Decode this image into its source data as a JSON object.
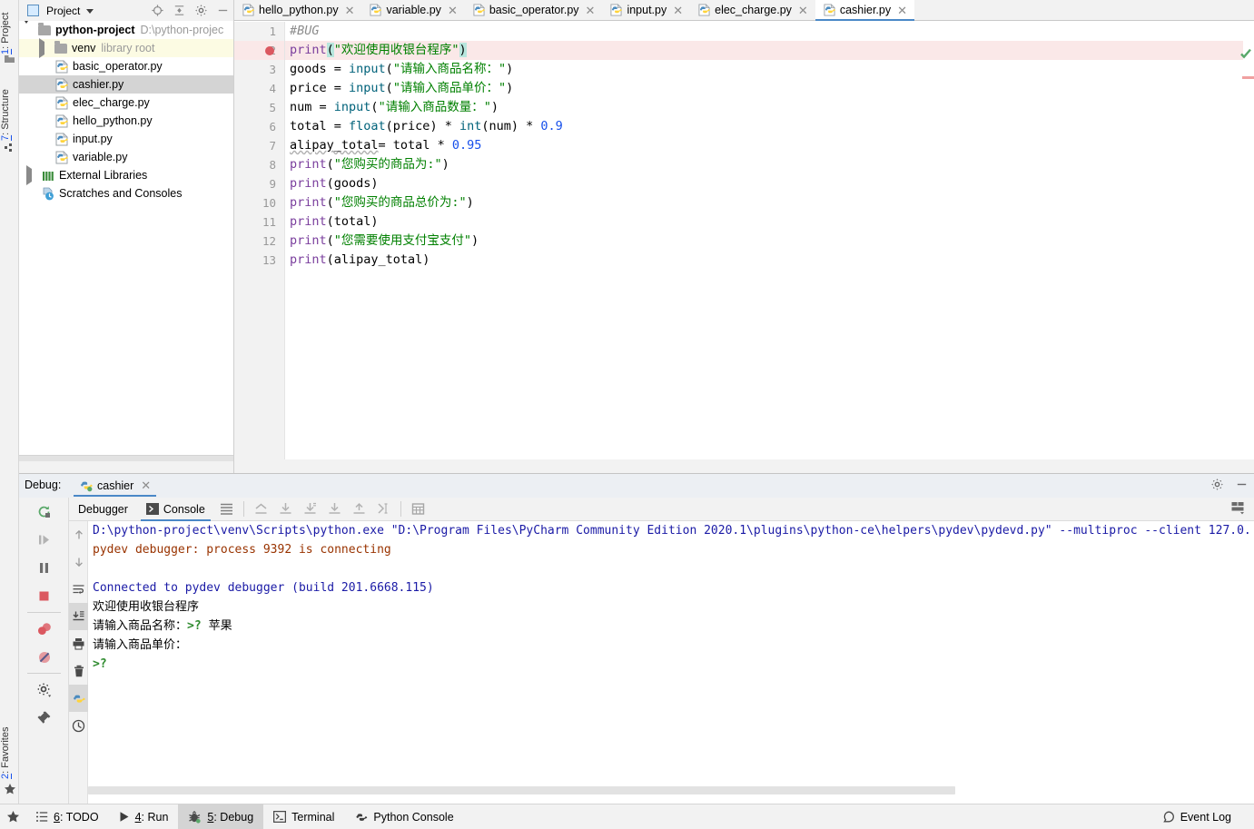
{
  "app": {
    "title": "PyCharm Community Edition 2020.1"
  },
  "left_strip": {
    "tabs": [
      {
        "num": "1",
        "label": ": Project",
        "icon": "project-icon"
      },
      {
        "num": "7",
        "label": ": Structure",
        "icon": "structure-icon"
      },
      {
        "num": "2",
        "label": ": Favorites",
        "icon": "star-icon"
      }
    ]
  },
  "project_panel": {
    "title": "Project",
    "icons": [
      "locate-icon",
      "collapse-all-icon",
      "gear-icon",
      "hide-icon"
    ],
    "tree": [
      {
        "label": "python-project",
        "suffix": "D:\\python-projec",
        "type": "folder",
        "expanded": true,
        "depth": 0,
        "bold": true
      },
      {
        "label": "venv",
        "suffix": "library root",
        "type": "folder",
        "expanded": false,
        "depth": 1,
        "highlight": "venv"
      },
      {
        "label": "basic_operator.py",
        "suffix": "",
        "type": "python",
        "depth": 2
      },
      {
        "label": "cashier.py",
        "suffix": "",
        "type": "python",
        "depth": 2,
        "selected": true
      },
      {
        "label": "elec_charge.py",
        "suffix": "",
        "type": "python",
        "depth": 2
      },
      {
        "label": "hello_python.py",
        "suffix": "",
        "type": "python",
        "depth": 2
      },
      {
        "label": "input.py",
        "suffix": "",
        "type": "python",
        "depth": 2
      },
      {
        "label": "variable.py",
        "suffix": "",
        "type": "python",
        "depth": 2
      },
      {
        "label": "External Libraries",
        "suffix": "",
        "type": "libraries",
        "expanded": false,
        "depth": 1
      },
      {
        "label": "Scratches and Consoles",
        "suffix": "",
        "type": "scratches",
        "depth": 1
      }
    ]
  },
  "editor": {
    "tabs": [
      {
        "label": "hello_python.py",
        "active": false
      },
      {
        "label": "variable.py",
        "active": false
      },
      {
        "label": "basic_operator.py",
        "active": false
      },
      {
        "label": "input.py",
        "active": false
      },
      {
        "label": "elec_charge.py",
        "active": false
      },
      {
        "label": "cashier.py",
        "active": true
      }
    ],
    "line_numbers": [
      "1",
      "2",
      "3",
      "4",
      "5",
      "6",
      "7",
      "8",
      "9",
      "10",
      "11",
      "12",
      "13"
    ],
    "breakpoint_line": 2,
    "code_lines": [
      "#BUG",
      "print(\"欢迎使用收银台程序\")",
      "goods = input(\"请输入商品名称：\")",
      "price = input(\"请输入商品单价：\")",
      "num = input(\"请输入商品数量：\")",
      "total = float(price) * int(num) * 0.9",
      "alipay_total= total * 0.95",
      "print(\"您购买的商品为:\")",
      "print(goods)",
      "print(\"您购买的商品总价为:\")",
      "print(total)",
      "print(\"您需要使用支付宝支付\")",
      "print(alipay_total)"
    ]
  },
  "debug": {
    "panel_label": "Debug:",
    "session_tab": "cashier",
    "tabs": [
      {
        "label": "Debugger",
        "active": false,
        "icon": ""
      },
      {
        "label": "Console",
        "active": true,
        "icon": "console-icon"
      }
    ],
    "toolbar_icons": [
      "soft-wrap-icon",
      "scroll-up-icon",
      "scroll-to-end-icon",
      "export-icon",
      "print-icon",
      "up-icon",
      "cursor-end-icon",
      "table-icon"
    ],
    "left_toolbar_icons": [
      "rerun-icon",
      "resume-icon",
      "pause-icon",
      "stop-icon",
      "view-breakpoints-icon",
      "mute-breakpoints-icon",
      "settings-icon",
      "pin-icon"
    ],
    "gutter_icons": [
      "rerun-icon",
      "up-icon",
      "down-icon",
      "soft-wrap-icon",
      "scroll-to-end-icon",
      "print-icon",
      "trash-icon",
      "python-console-icon",
      "history-icon"
    ],
    "header_icons": [
      "gear-icon",
      "minimize-icon",
      "layout-icon"
    ],
    "console_output": [
      {
        "text": "D:\\python-project\\venv\\Scripts\\python.exe \"D:\\Program Files\\PyCharm Community Edition 2020.1\\plugins\\python-ce\\helpers\\pydev\\pydevd.py\" --multiproc --client 127.0.",
        "color": "blue"
      },
      {
        "text": "pydev debugger: process 9392 is connecting",
        "color": "red"
      },
      {
        "text": "",
        "color": "black"
      },
      {
        "text": "Connected to pydev debugger (build 201.6668.115)",
        "color": "blue"
      },
      {
        "text": "欢迎使用收银台程序",
        "color": "black"
      },
      {
        "text": "请输入商品名称：",
        "color": "black",
        "prompt": ">?",
        "input": "苹果"
      },
      {
        "text": "请输入商品单价：",
        "color": "black"
      },
      {
        "text": "",
        "color": "black",
        "prompt": ">?"
      }
    ]
  },
  "statusbar": {
    "items": [
      {
        "num": "6",
        "label": ": TODO",
        "icon": "todo-icon",
        "active": false
      },
      {
        "num": "4",
        "label": ": Run",
        "icon": "run-icon",
        "active": false
      },
      {
        "num": "5",
        "label": ": Debug",
        "icon": "debug-icon",
        "active": true
      },
      {
        "num": "",
        "label": "Terminal",
        "icon": "terminal-icon",
        "active": false
      },
      {
        "num": "",
        "label": "Python Console",
        "icon": "python-console-icon",
        "active": false
      }
    ],
    "event_log": "Event Log",
    "star_icon": "favorites-star-icon"
  },
  "colors": {
    "accent": "#4a88c7",
    "breakpoint": "#db5860",
    "breakpoint_line_bg": "#fae8e8",
    "selection": "#d4d4d4",
    "panel_bg": "#f2f2f2",
    "console_blue": "#1a1aa6",
    "console_red": "#993300",
    "prompt_green": "#2e8b2e"
  }
}
